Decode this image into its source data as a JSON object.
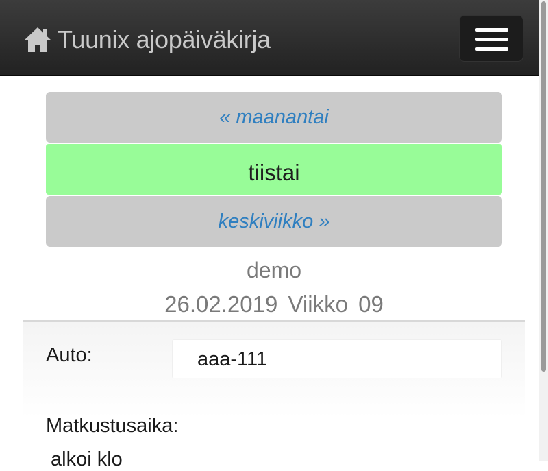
{
  "navbar": {
    "brand_title": "Tuunix ajopäiväkirja",
    "home_icon": "home-icon",
    "menu_icon": "hamburger-menu-icon"
  },
  "day_nav": {
    "previous": "« maanantai",
    "current": "tiistai",
    "next": "keskiviikko »"
  },
  "info": {
    "user": "demo",
    "date_week": "26.02.2019 Viikko 09"
  },
  "form": {
    "auto_label": "Auto:",
    "auto_value": "aaa-111",
    "travel_time_label": "Matkustusaika:",
    "start_label": "alkoi klo"
  },
  "colors": {
    "navbar": "#2b2b2b",
    "current_day": "#98fc98",
    "other_day": "#cacaca",
    "link": "#2f7fc0"
  }
}
